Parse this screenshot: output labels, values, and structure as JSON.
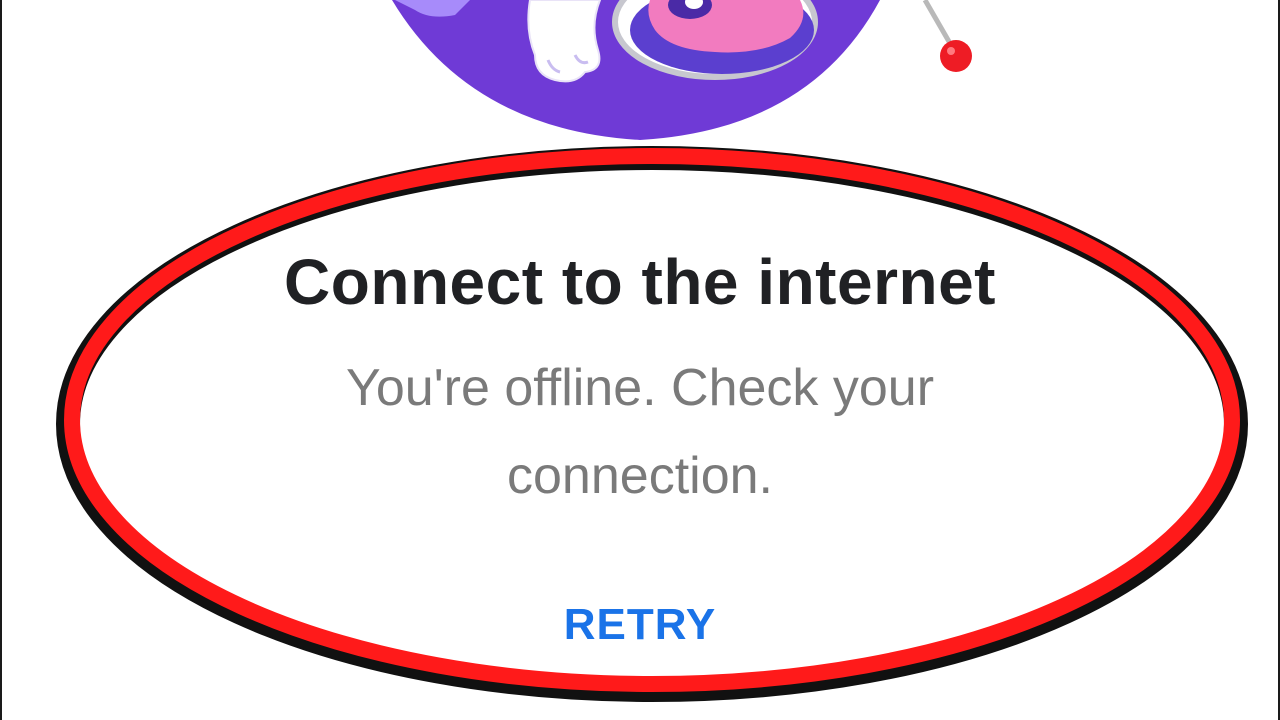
{
  "dialog": {
    "title": "Connect to the internet",
    "message": "You're offline. Check your connection.",
    "retry_label": "RETRY"
  },
  "colors": {
    "title": "#202124",
    "message": "#7a7a7a",
    "accent": "#1a73e8",
    "annotation_ring": "#ff1a1a",
    "illustration_purple": "#6f3ad6"
  },
  "icons": {
    "illustration": "offline-mascot-illustration",
    "annotation": "red-ellipse-highlight"
  }
}
